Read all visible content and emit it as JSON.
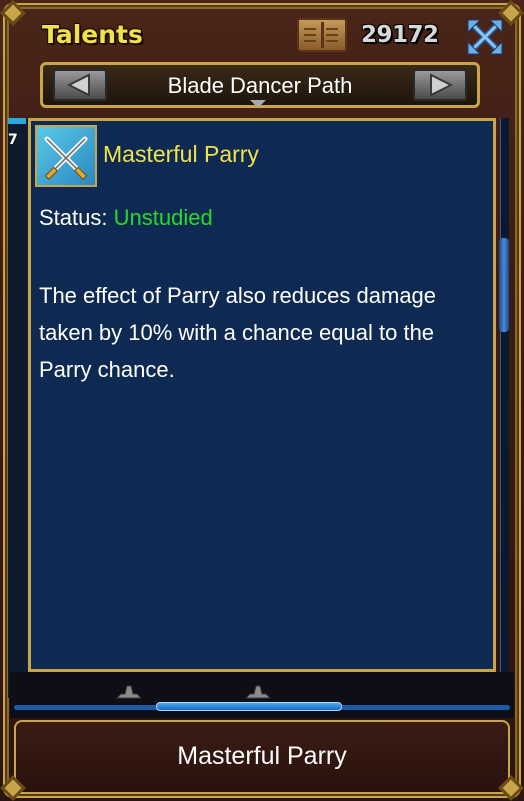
{
  "header": {
    "title": "Talents",
    "points": "29172",
    "book_icon": "book-icon",
    "close_icon": "expand-arrows-icon"
  },
  "path_selector": {
    "prev_icon": "left-arrow-icon",
    "next_icon": "right-arrow-icon",
    "path_name": "Blade Dancer Path"
  },
  "left_tab": {
    "text": "7"
  },
  "talent": {
    "icon": "crossed-swords-icon",
    "name": "Masterful Parry",
    "status_label": "Status:",
    "status_value": "Unstudied",
    "description": "The effect of Parry also reduces damage taken by 10% with a chance equal to the Parry chance."
  },
  "footer": {
    "selected_label": "Masterful Parry"
  },
  "colors": {
    "title": "#f0e24a",
    "status_unstudied": "#2ad82a",
    "panel_bg": "#0e2a52",
    "gold_border": "#c8a54a",
    "scroll_accent": "#2aa8e0"
  }
}
